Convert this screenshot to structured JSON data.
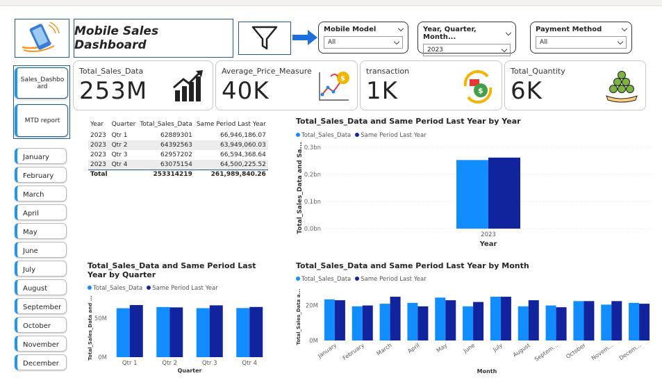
{
  "header": {
    "title": "Mobile Sales Dashboard"
  },
  "slicers": [
    {
      "label": "Mobile Model",
      "value": "All"
    },
    {
      "label": "Year, Quarter, Month...",
      "value": "2023"
    },
    {
      "label": "Payment Method",
      "value": "All"
    }
  ],
  "nav": {
    "sales_dashboard": "Sales_Dashboard",
    "mtd_report": "MTD report"
  },
  "kpis": [
    {
      "label": "Total_Sales_Data",
      "value": "253M",
      "icon": "growth-chart-icon"
    },
    {
      "label": "Average_Price_Measure",
      "value": "40K",
      "icon": "price-trend-icon"
    },
    {
      "label": "transaction",
      "value": "1K",
      "icon": "money-cycle-icon"
    },
    {
      "label": "Total_Quantity",
      "value": "6K",
      "icon": "coin-stack-hand-icon"
    }
  ],
  "months": [
    "January",
    "February",
    "March",
    "April",
    "May",
    "June",
    "July",
    "August",
    "September",
    "October",
    "November",
    "December"
  ],
  "matrix": {
    "headers": [
      "Year",
      "Quarter",
      "Total_Sales_Data",
      "Same Period Last Year"
    ],
    "rows": [
      [
        "2023",
        "Qtr 1",
        "62889301",
        "66,946,186.07"
      ],
      [
        "2023",
        "Qtr 2",
        "64392563",
        "63,949,060.03"
      ],
      [
        "2023",
        "Qtr 3",
        "62957202",
        "66,594,368.64"
      ],
      [
        "2023",
        "Qtr 4",
        "63075154",
        "64,500,225.52"
      ]
    ],
    "total": [
      "Total",
      "",
      "253314219",
      "261,989,840.26"
    ]
  },
  "colors": {
    "series1": "#118dff",
    "series2": "#12239e",
    "accent": "#1f5c8b"
  },
  "chart_data": [
    {
      "type": "bar",
      "title": "Total_Sales_Data and Same Period Last Year by Year",
      "xlabel": "Year",
      "ylabel": "Total_Sales_Data and Sa...",
      "categories": [
        "2023"
      ],
      "yticks": [
        "0.0bn",
        "0.1bn",
        "0.2bn",
        "0.3bn"
      ],
      "ylim": [
        0,
        0.3
      ],
      "series": [
        {
          "name": "Total_Sales_Data",
          "values": [
            0.253
          ]
        },
        {
          "name": "Same Period Last Year",
          "values": [
            0.262
          ]
        }
      ],
      "legend": "top-left"
    },
    {
      "type": "bar",
      "title": "Total_Sales_Data and Same Period Last Year by Quarter",
      "xlabel": "Quarter",
      "ylabel": "Total_Sales_Data and ...",
      "categories": [
        "Qtr 1",
        "Qtr 2",
        "Qtr 3",
        "Qtr 4"
      ],
      "yticks": [
        "0M",
        "50M"
      ],
      "ylim": [
        0,
        75
      ],
      "series": [
        {
          "name": "Total_Sales_Data",
          "values": [
            62.89,
            64.39,
            62.96,
            63.08
          ]
        },
        {
          "name": "Same Period Last Year",
          "values": [
            66.95,
            63.95,
            66.59,
            64.5
          ]
        }
      ],
      "legend": "top-left"
    },
    {
      "type": "bar",
      "title": "Total_Sales_Data and Same Period Last Year by Month",
      "xlabel": "Month",
      "ylabel": "Total_Sales_Data a...",
      "categories": [
        "January",
        "February",
        "March",
        "April",
        "May",
        "June",
        "July",
        "August",
        "Septem...",
        "October",
        "Novem...",
        "Decem..."
      ],
      "yticks": [
        "0M",
        "20M"
      ],
      "ylim": [
        0,
        27
      ],
      "series": [
        {
          "name": "Total_Sales_Data",
          "values": [
            23.5,
            19.5,
            21.0,
            21.5,
            24.5,
            19.5,
            25.0,
            19.5,
            20.0,
            22.5,
            20.5,
            21.5
          ]
        },
        {
          "name": "Same Period Last Year",
          "values": [
            23.0,
            20.0,
            25.0,
            19.5,
            23.0,
            22.0,
            25.0,
            23.0,
            19.0,
            22.5,
            22.5,
            21.0
          ]
        }
      ],
      "legend": "top-left"
    }
  ]
}
